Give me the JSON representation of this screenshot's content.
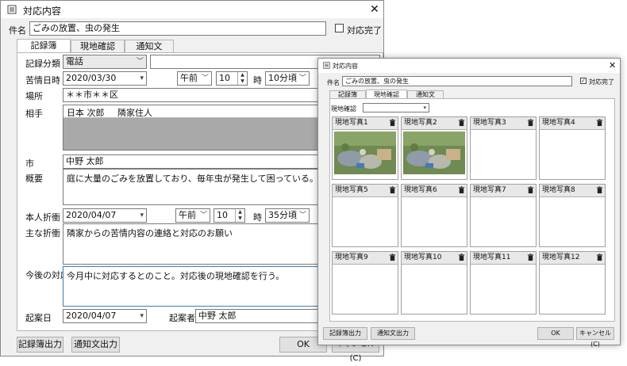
{
  "main_window": {
    "title": "対応内容",
    "subject_label": "件名",
    "subject_value": "ごみの放置、虫の発生",
    "complete_label": "対応完了",
    "tabs": [
      "記録簿",
      "現地確認",
      "通知文"
    ],
    "record_type_label": "記録分類",
    "record_type_value": "電話",
    "complaint_datetime_label": "苦情日時",
    "complaint_date": "2020/03/30",
    "complaint_ampm": "午前",
    "complaint_hour": "10",
    "hour_unit": "時",
    "complaint_minute": "10分頃",
    "place_label": "場所",
    "place_value": "＊＊市＊＊区",
    "other_party_label": "相手",
    "other_party_name": "日本 次郎",
    "other_party_relation": "隣家住人",
    "city_label": "市",
    "city_value": "中野 太郎",
    "summary_label": "概要",
    "summary_value": "庭に大量のごみを放置しており、毎年虫が発生して困っている。",
    "negotiation_label": "本人折衝",
    "negotiation_date": "2020/04/07",
    "negotiation_ampm": "午前",
    "negotiation_hour": "10",
    "negotiation_minute": "35分頃",
    "main_negotiation_label": "主な折衝",
    "main_negotiation_value": "隣家からの苦情内容の連絡と対応のお願い",
    "future_label": "今後の対応",
    "future_value": "今月中に対応するとのこと。対応後の現地確認を行う。",
    "drafted_date_label": "起案日",
    "drafted_date_value": "2020/04/07",
    "drafter_label": "起案者",
    "drafter_value": "中野 太郎",
    "buttons": {
      "record_output": "記録簿出力",
      "notice_output": "通知文出力",
      "ok": "OK",
      "cancel": "キャンセル(C)"
    }
  },
  "dialog": {
    "title": "対応内容",
    "subject_label": "件名",
    "subject_value": "ごみの放置、虫の発生",
    "complete_label": "対応完了",
    "tabs": [
      "記録簿",
      "現地確認",
      "通知文"
    ],
    "site_check_label": "現地確認",
    "photos": [
      {
        "label": "現地写真1",
        "has_image": true
      },
      {
        "label": "現地写真2",
        "has_image": true
      },
      {
        "label": "現地写真3",
        "has_image": false
      },
      {
        "label": "現地写真4",
        "has_image": false
      },
      {
        "label": "現地写真5",
        "has_image": false
      },
      {
        "label": "現地写真6",
        "has_image": false
      },
      {
        "label": "現地写真7",
        "has_image": false
      },
      {
        "label": "現地写真8",
        "has_image": false
      },
      {
        "label": "現地写真9",
        "has_image": false
      },
      {
        "label": "現地写真10",
        "has_image": false
      },
      {
        "label": "現地写真11",
        "has_image": false
      },
      {
        "label": "現地写真12",
        "has_image": false
      }
    ],
    "buttons": {
      "record_output": "記録簿出力",
      "notice_output": "通知文出力",
      "ok": "OK",
      "cancel": "キャンセル(C)"
    }
  }
}
